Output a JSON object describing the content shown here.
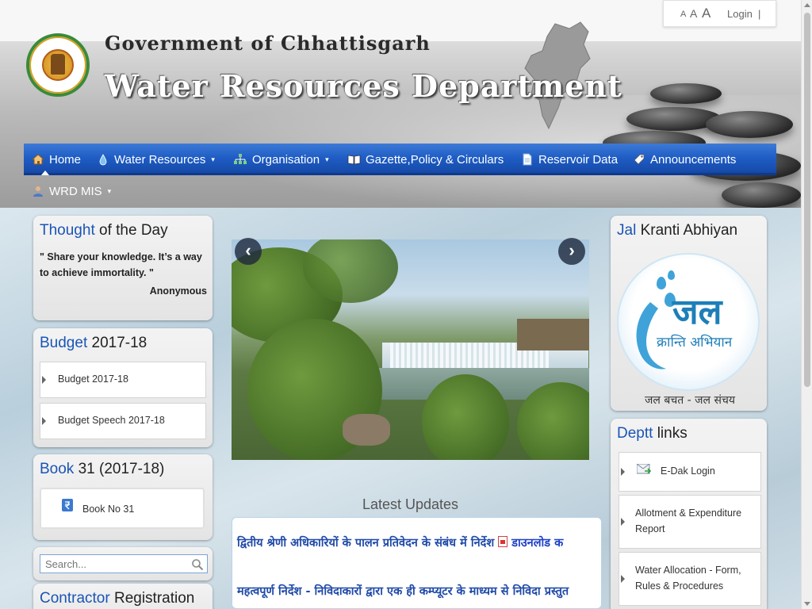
{
  "header": {
    "gov_title": "Government of Chhattisgarh",
    "dept_title": "Water Resources Department"
  },
  "utility": {
    "font_small": "A",
    "font_medium": "A",
    "font_large": "A",
    "login": "Login",
    "separator": "|"
  },
  "nav": {
    "items": [
      {
        "label": "Home",
        "icon": "home-icon"
      },
      {
        "label": "Water Resources",
        "icon": "water-drop-icon",
        "has_dropdown": true
      },
      {
        "label": "Organisation",
        "icon": "org-chart-icon",
        "has_dropdown": true
      },
      {
        "label": "Gazette,Policy & Circulars",
        "icon": "book-icon"
      },
      {
        "label": "Reservoir Data",
        "icon": "document-icon"
      },
      {
        "label": "Announcements",
        "icon": "tag-icon"
      },
      {
        "label": "WRD MIS",
        "icon": "user-icon",
        "has_dropdown": true
      }
    ],
    "caret": "▾",
    "active_index": 0,
    "accent_color": "#1e5cc4"
  },
  "thought": {
    "title_hl": "Thought",
    "title_rest": " of the Day",
    "quote": "\" Share your knowledge. It’s a way to achieve immortality. \"",
    "author": "Anonymous"
  },
  "budget": {
    "title_hl": "Budget",
    "title_rest": " 2017-18",
    "links": [
      "Budget 2017-18",
      "Budget Speech 2017-18"
    ]
  },
  "book": {
    "title_hl": "Book",
    "title_rest": " 31 (2017-18)",
    "link": "Book No 31"
  },
  "search": {
    "placeholder": "Search..."
  },
  "contractor": {
    "title_hl": "Contractor",
    "title_rest": " Registration"
  },
  "slider": {
    "prev": "‹",
    "next": "›"
  },
  "latest_updates": {
    "title": "Latest Updates",
    "items": [
      {
        "text": "द्वितीय श्रेणी अधिकारियों के पालन प्रतिवेदन के संबंध में निर्देश",
        "download": "डाउनलोड क"
      },
      {
        "text": "महत्वपूर्ण निर्देश - निविदाकारों द्वारा एक ही कम्प्यूटर के माध्यम से निविदा प्रस्तुत"
      }
    ]
  },
  "jal_kranti": {
    "title_hl": "Jal",
    "title_rest": " Kranti Abhiyan",
    "logo_text": "जल",
    "logo_sub": "क्रान्ति अभियान",
    "tagline": "जल बचत  -  जल संचय"
  },
  "deptt_links": {
    "title_hl": "Deptt",
    "title_rest": " links",
    "links": [
      "E-Dak Login",
      "Allotment & Expenditure Report",
      "Water Allocation - Form, Rules & Procedures"
    ]
  }
}
